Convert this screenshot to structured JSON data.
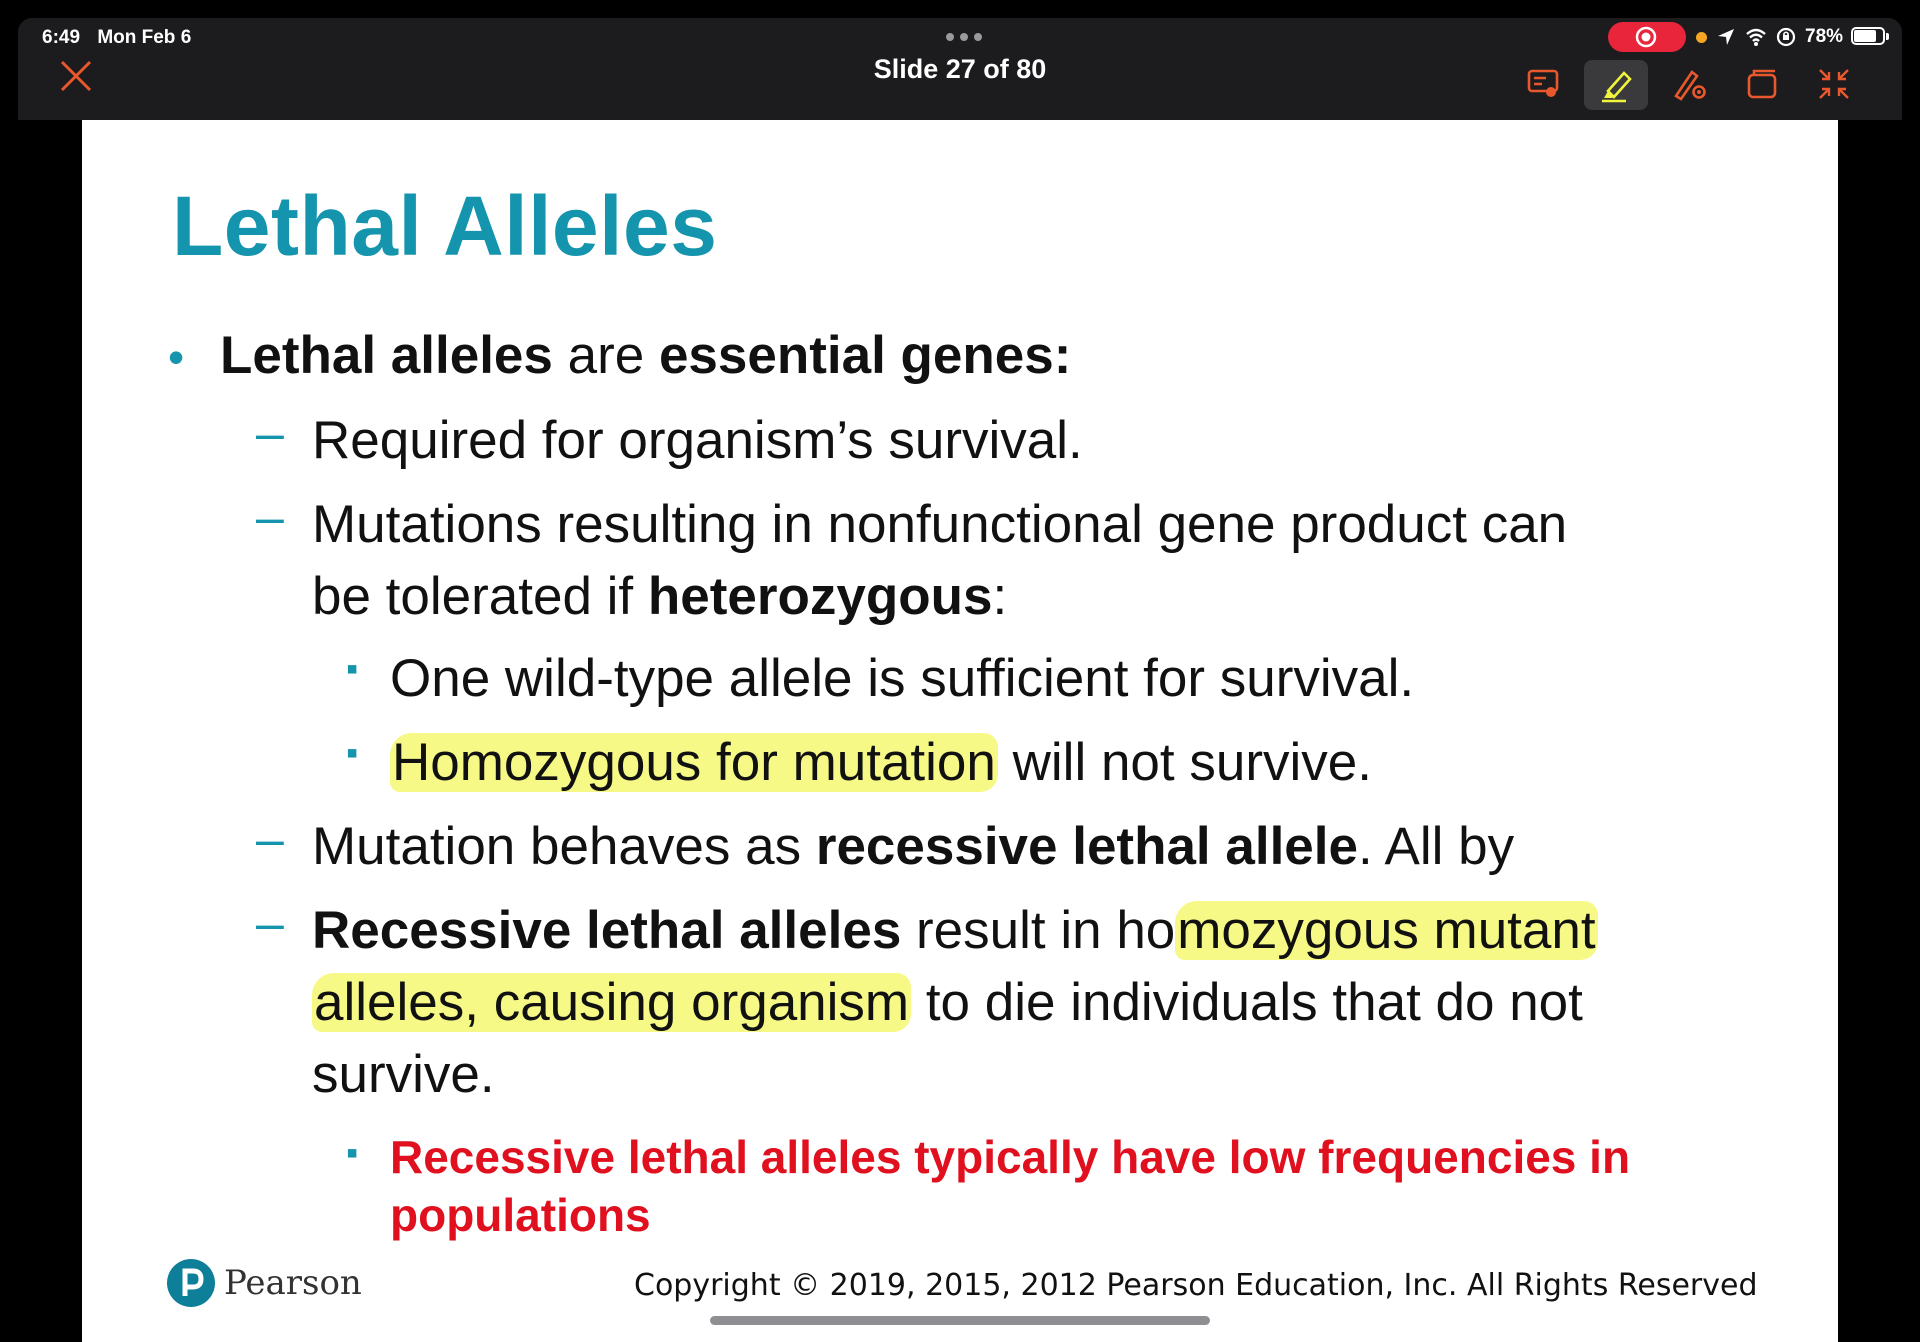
{
  "status_bar": {
    "time": "6:49",
    "date": "Mon Feb 6",
    "battery": "78%",
    "battery_level": 0.78
  },
  "toolbar": {
    "slide_counter": "Slide 27 of 80",
    "tools": [
      "slideshow-icon",
      "highlighter-icon",
      "pen-settings-icon",
      "window-icon",
      "collapse-icon"
    ],
    "accent_color": "#e8582c",
    "highlight_color": "#f0f53c"
  },
  "slide": {
    "title": "Lethal Alleles",
    "bullet1": {
      "t1": "Lethal alleles",
      "t2": " are ",
      "t3": "essential genes:"
    },
    "sub1": "Required for organism’s survival.",
    "sub2": {
      "l1": "Mutations resulting in nonfunctional gene product can",
      "l2a": "be tolerated if ",
      "l2b": "heterozygous",
      "l2c": ":"
    },
    "sub2a": "One wild-type allele is sufficient for survival.",
    "sub2b": {
      "highlighted": "Homozygous for mutation",
      "rest": " will not survive."
    },
    "sub3": {
      "t1": "Mutation behaves as ",
      "t2": "recessive lethal allele",
      "t3": ". All by"
    },
    "sub4": {
      "t1": "Recessive lethal alleles",
      "t2": " result in ho",
      "t3": "mozygous mutant",
      "l2a": "alleles, causing organism",
      "l2b": " to die individuals that do not",
      "l3": "survive."
    },
    "sub4a": {
      "l1": "Recessive lethal alleles typically have low frequencies in",
      "l2": "populations"
    },
    "bullet_dot": "•",
    "dash": "–",
    "square": "▪",
    "brand": "Pearson",
    "copyright": "Copyright © 2019, 2015, 2012 Pearson Education, Inc. All Rights Reserved"
  }
}
